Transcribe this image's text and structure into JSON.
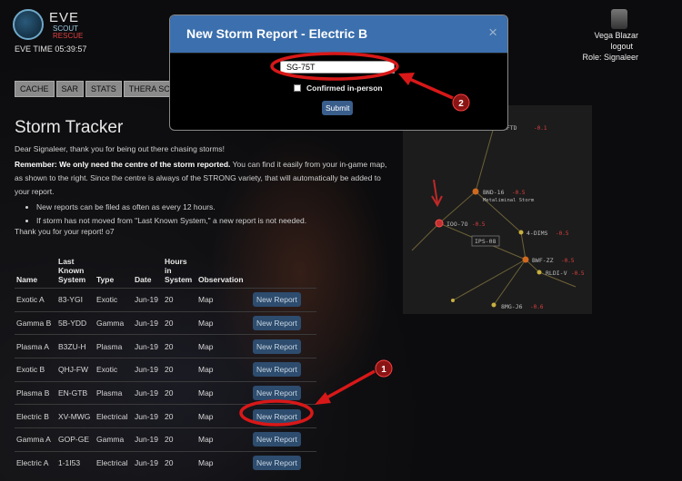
{
  "header": {
    "logo_title": "EVE",
    "logo_scout": "SCOUT",
    "logo_rescue": "RESCUE",
    "eve_time": "EVE TIME 05:39:57",
    "user_name": "Vega Blazar",
    "logout": "logout",
    "role": "Role: Signaleer"
  },
  "tabs": [
    "CACHE",
    "SAR",
    "STATS",
    "THERA SCA"
  ],
  "content": {
    "title": "Storm Tracker",
    "greeting": "Dear Signaleer, thank you for being out there chasing storms!",
    "remember_bold": "Remember: We only need the centre of the storm reported.",
    "remember_rest": " You can find it easily from your in-game map, as shown to the right. Since the centre is always of the STRONG variety, that will automatically be added to your report.",
    "bullets": [
      "New reports can be filed as often as every 12 hours.",
      "If storm has not moved from \"Last Known System,\" a new report is not needed."
    ],
    "thanks": "Thank you for your report! o7"
  },
  "table": {
    "headers": [
      "Name",
      "Last Known System",
      "Type",
      "Date",
      "Hours in System",
      "Observation",
      ""
    ],
    "header_lines": [
      [
        "Name"
      ],
      [
        "Last",
        "Known",
        "System"
      ],
      [
        "Type"
      ],
      [
        "Date"
      ],
      [
        "Hours",
        "in",
        "System"
      ],
      [
        "Observation"
      ],
      [
        ""
      ]
    ],
    "rows": [
      {
        "name": "Exotic A",
        "system": "83-YGI",
        "type": "Exotic",
        "date": "Jun-19",
        "hours": "20",
        "observation": "Map",
        "action": "New Report"
      },
      {
        "name": "Gamma B",
        "system": "5B-YDD",
        "type": "Gamma",
        "date": "Jun-19",
        "hours": "20",
        "observation": "Map",
        "action": "New Report"
      },
      {
        "name": "Plasma A",
        "system": "B3ZU-H",
        "type": "Plasma",
        "date": "Jun-19",
        "hours": "20",
        "observation": "Map",
        "action": "New Report"
      },
      {
        "name": "Exotic B",
        "system": "QHJ-FW",
        "type": "Exotic",
        "date": "Jun-19",
        "hours": "20",
        "observation": "Map",
        "action": "New Report"
      },
      {
        "name": "Plasma B",
        "system": "EN-GTB",
        "type": "Plasma",
        "date": "Jun-19",
        "hours": "20",
        "observation": "Map",
        "action": "New Report"
      },
      {
        "name": "Electric B",
        "system": "XV-MWG",
        "type": "Electrical",
        "date": "Jun-19",
        "hours": "20",
        "observation": "Map",
        "action": "New Report"
      },
      {
        "name": "Gamma A",
        "system": "GOP-GE",
        "type": "Gamma",
        "date": "Jun-19",
        "hours": "20",
        "observation": "Map",
        "action": "New Report"
      },
      {
        "name": "Electric A",
        "system": "1-1I53",
        "type": "Electrical",
        "date": "Jun-19",
        "hours": "20",
        "observation": "Map",
        "action": "New Report"
      }
    ]
  },
  "map": {
    "systems": [
      {
        "label": "1-FTD",
        "sec": "-0.1"
      },
      {
        "label": "BND-16",
        "sec": "-0.5",
        "sub": "Metaliminal Storm"
      },
      {
        "label": "IOO-7O",
        "sec": "-0.5"
      },
      {
        "label": "IPS-08",
        "sec": ""
      },
      {
        "label": "4-DIMS",
        "sec": "-0.5"
      },
      {
        "label": "BWF-ZZ",
        "sec": "-0.5"
      },
      {
        "label": "RLDI-V",
        "sec": "-0.5"
      },
      {
        "label": "8MG-J6",
        "sec": "-0.6"
      }
    ]
  },
  "modal": {
    "title": "New Storm Report - Electric B",
    "close": "×",
    "system_value": "SG-75T",
    "confirm_label": "Confirmed in-person",
    "submit": "Submit"
  },
  "annotations": {
    "step1": "1",
    "step2": "2"
  },
  "colors": {
    "accent": "#3b6fad",
    "button": "#2d4c6e",
    "annotation": "#d81818",
    "badge": "#8a1414"
  }
}
